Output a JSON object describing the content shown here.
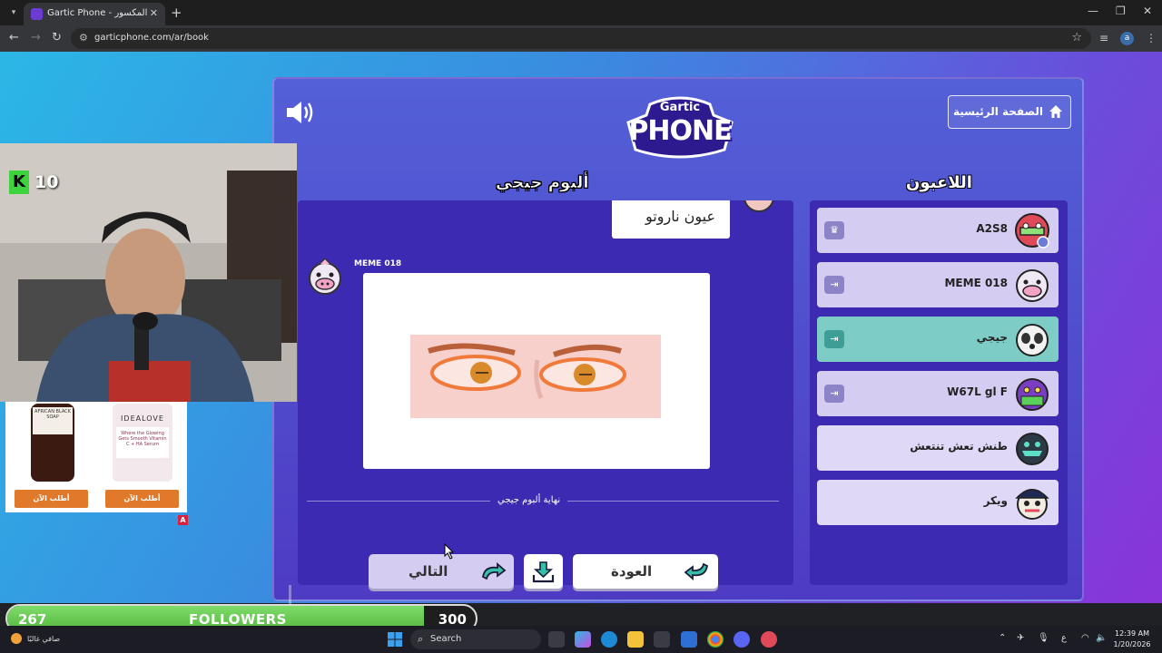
{
  "browser": {
    "tab_title": "Gartic Phone - الهاتف المكسور",
    "url": "garticphone.com/ar/book",
    "new_tab": "+",
    "close_tab": "✕",
    "profile_initial": "a"
  },
  "game": {
    "logo_top": "Gartic",
    "logo_main": "PHONE",
    "home_label": "الصفحة الرئيسية",
    "album_title": "ألبوم جيجي",
    "players_title": "اللاعبون",
    "previous_text": "عيون ناروتو",
    "author_name": "MEME 018",
    "album_end": "نهاية ألبوم جيجي",
    "next_label": "التالي",
    "back_label": "العودة",
    "players": [
      {
        "name": "A2S8",
        "badge": "♛"
      },
      {
        "name": "MEME 018",
        "badge": "⇥"
      },
      {
        "name": "جيجي",
        "badge": "⇥"
      },
      {
        "name": "W67L gl F",
        "badge": "⇥"
      },
      {
        "name": "طنش تعش تنتعش",
        "badge": ""
      },
      {
        "name": "ويكر",
        "badge": ""
      }
    ]
  },
  "overlay": {
    "k_letter": "K",
    "k_value": "10",
    "ad_product_1": "AFRICAN BLACK SOAP",
    "ad_product_2": "IDEALOVE",
    "ad_product_2_sub": "Where the Glowing Gets Smooth Vitamin C + HA Serum",
    "ad_button_1": "أطلب الآن",
    "ad_button_2": "أطلب الآن",
    "ad_marker": "A",
    "followers_current": "267",
    "followers_label": "FOLLOWERS",
    "followers_goal": "300",
    "followers_progress": 0.89
  },
  "taskbar": {
    "weather_text": "صافي غالبًا",
    "search_text": "Search",
    "time": "12:39 AM",
    "date": "1/20/2026",
    "lang": "ع"
  },
  "colors": {
    "accent_purple": "#3c2ab2",
    "highlight_teal": "#7dcdc6",
    "player_row": "#d5ccf2"
  }
}
